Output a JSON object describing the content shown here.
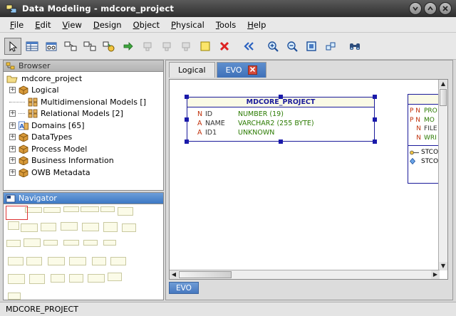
{
  "window": {
    "title": "Data Modeling - mdcore_project",
    "controls": [
      "minimize",
      "maximize",
      "close"
    ]
  },
  "menu": [
    {
      "mnemonic": "F",
      "rest": "ile"
    },
    {
      "mnemonic": "E",
      "rest": "dit"
    },
    {
      "mnemonic": "V",
      "rest": "iew"
    },
    {
      "mnemonic": "D",
      "rest": "esign"
    },
    {
      "mnemonic": "O",
      "rest": "bject"
    },
    {
      "mnemonic": "P",
      "rest": "hysical"
    },
    {
      "mnemonic": "T",
      "rest": "ools"
    },
    {
      "mnemonic": "H",
      "rest": "elp"
    }
  ],
  "toolbar": {
    "icons": [
      "select-arrow-icon",
      "new-table-icon",
      "new-view-icon",
      "new-relation-icon",
      "new-fk-icon",
      "new-ref-icon",
      "arrow-right-icon",
      "disabled-1-icon",
      "disabled-2-icon",
      "disabled-3-icon",
      "note-icon",
      "delete-icon",
      "back-icon",
      "zoom-in-icon",
      "zoom-out-icon",
      "fit-screen-icon",
      "layout-icon",
      "find-binoculars-icon"
    ]
  },
  "browser": {
    "header": "Browser",
    "root": "mdcore_project",
    "items": [
      {
        "label": "Logical",
        "expander": "+",
        "icon": "cube"
      },
      {
        "label": "Multidimensional Models []",
        "expander": "",
        "icon": "grid"
      },
      {
        "label": "Relational Models [2]",
        "expander": "+",
        "icon": "grid"
      },
      {
        "label": "Domains [65]",
        "expander": "+",
        "icon": "domain"
      },
      {
        "label": "DataTypes",
        "expander": "+",
        "icon": "cube"
      },
      {
        "label": "Process Model",
        "expander": "+",
        "icon": "cube"
      },
      {
        "label": "Business Information",
        "expander": "+",
        "icon": "cube"
      },
      {
        "label": "OWB Metadata",
        "expander": "+",
        "icon": "cube"
      }
    ]
  },
  "navigator": {
    "header": "Navigator"
  },
  "editor": {
    "tabs": [
      {
        "label": "Logical",
        "selected": false
      },
      {
        "label": "EVO",
        "selected": true
      }
    ],
    "bottom_tab": "EVO",
    "entity": {
      "name": "MDCORE_PROJECT",
      "fields": [
        {
          "flag": "N",
          "name": "ID",
          "type": "NUMBER (19)"
        },
        {
          "flag": "A",
          "name": "NAME",
          "type": "VARCHAR2 (255 BYTE)"
        },
        {
          "flag": "A",
          "name": "ID1",
          "type": "UNKNOWN"
        }
      ]
    },
    "entity2": {
      "fields": [
        {
          "flags": "P N",
          "name": "PRO"
        },
        {
          "flags": "P N",
          "name": "MO"
        },
        {
          "flags": "N",
          "name": "FILE"
        },
        {
          "flags": "N",
          "name": "WRI"
        }
      ],
      "keys": [
        {
          "icon": "key-icon",
          "name": "STCO"
        },
        {
          "icon": "diamond-icon",
          "name": "STCO"
        }
      ]
    }
  },
  "status": {
    "text": "MDCORE_PROJECT"
  }
}
